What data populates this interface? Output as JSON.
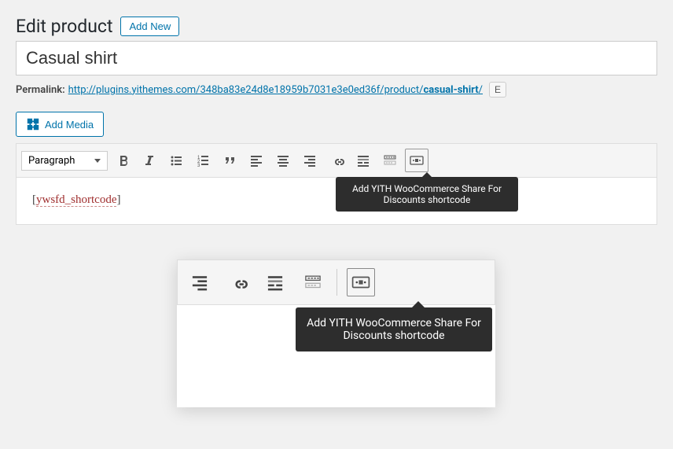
{
  "header": {
    "title": "Edit product",
    "add_new": "Add New"
  },
  "product": {
    "title": "Casual shirt"
  },
  "permalink": {
    "label": "Permalink:",
    "url_base": "http://plugins.yithemes.com/348ba83e24d8e18959b7031e3e0ed36f/product/",
    "slug": "casual-shirt",
    "trail": "/",
    "edit_label": "E"
  },
  "media": {
    "add_media": "Add Media"
  },
  "toolbar": {
    "format": "Paragraph",
    "tooltip": "Add YITH WooCommerce Share For Discounts shortcode"
  },
  "editor": {
    "open_bracket": "[",
    "tag": "ywsfd_shortcode",
    "close_bracket": "]"
  },
  "zoom": {
    "tooltip": "Add YITH WooCommerce Share For Discounts shortcode"
  },
  "icons": {
    "media": "media-icon",
    "bold": "bold-icon",
    "italic": "italic-icon",
    "ul": "bullet-list-icon",
    "ol": "numbered-list-icon",
    "quote": "blockquote-icon",
    "align_l": "align-left-icon",
    "align_c": "align-center-icon",
    "align_r": "align-right-icon",
    "link": "link-icon",
    "more": "readmore-icon",
    "kitchen": "toolbar-toggle-icon",
    "yith": "yith-shortcode-icon"
  }
}
